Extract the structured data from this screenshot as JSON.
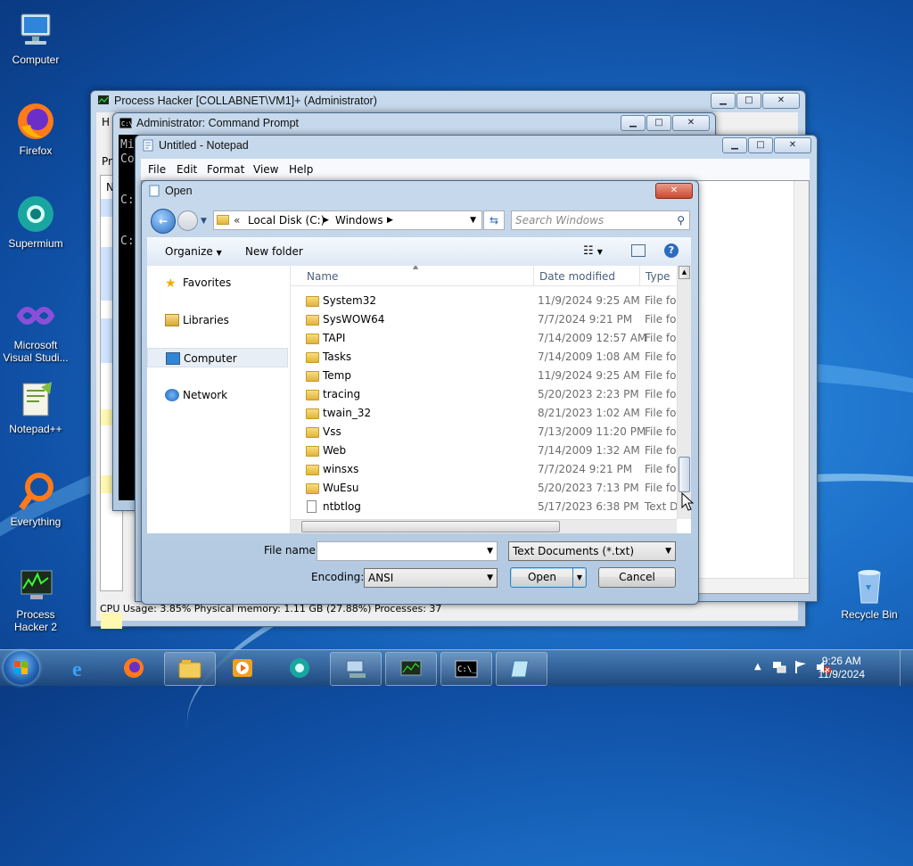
{
  "desktop": {
    "icons": [
      {
        "label": "Computer",
        "icon": "computer-icon"
      },
      {
        "label": "Firefox",
        "icon": "firefox-icon"
      },
      {
        "label": "Supermium",
        "icon": "supermium-icon"
      },
      {
        "label": "Microsoft Visual Studi...",
        "icon": "visual-studio-icon"
      },
      {
        "label": "Notepad++",
        "icon": "notepadpp-icon"
      },
      {
        "label": "Everything",
        "icon": "everything-icon"
      },
      {
        "label": "Process Hacker 2",
        "icon": "process-hacker-icon"
      },
      {
        "label": "Recycle Bin",
        "icon": "recycle-bin-icon"
      }
    ]
  },
  "process_hacker": {
    "title": "Process Hacker [COLLABNET\\VM1]+ (Administrator)",
    "menu_fragment": "H",
    "tab_fragment": "Pr",
    "col_fragment": "N",
    "status": "CPU Usage: 3.85%    Physical memory: 1.11 GB (27.88%)    Processes: 37"
  },
  "cmd": {
    "title": "Administrator:  Command Prompt",
    "lines": [
      "Mi",
      "Co",
      "",
      "C:",
      "",
      "C:"
    ]
  },
  "notepad": {
    "title": "Untitled - Notepad",
    "menu": [
      "File",
      "Edit",
      "Format",
      "View",
      "Help"
    ]
  },
  "open_dialog": {
    "title": "Open",
    "breadcrumb": [
      "Local Disk (C:)",
      "Windows"
    ],
    "search_placeholder": "Search Windows",
    "toolbar": {
      "organize": "Organize",
      "new_folder": "New folder"
    },
    "nav": [
      {
        "label": "Favorites",
        "icon": "star-icon"
      },
      {
        "label": "Libraries",
        "icon": "libraries-icon"
      },
      {
        "label": "Computer",
        "icon": "computer-icon",
        "selected": true
      },
      {
        "label": "Network",
        "icon": "network-icon"
      }
    ],
    "columns": {
      "name": "Name",
      "date": "Date modified",
      "type": "Type"
    },
    "files": [
      {
        "name": "System32",
        "date": "11/9/2024 9:25 AM",
        "type": "File fol",
        "kind": "folder"
      },
      {
        "name": "SysWOW64",
        "date": "7/7/2024 9:21 PM",
        "type": "File fol",
        "kind": "folder"
      },
      {
        "name": "TAPI",
        "date": "7/14/2009 12:57 AM",
        "type": "File fol",
        "kind": "folder"
      },
      {
        "name": "Tasks",
        "date": "7/14/2009 1:08 AM",
        "type": "File fol",
        "kind": "folder"
      },
      {
        "name": "Temp",
        "date": "11/9/2024 9:25 AM",
        "type": "File fol",
        "kind": "folder"
      },
      {
        "name": "tracing",
        "date": "5/20/2023 2:23 PM",
        "type": "File fol",
        "kind": "folder"
      },
      {
        "name": "twain_32",
        "date": "8/21/2023 1:02 AM",
        "type": "File fol",
        "kind": "folder"
      },
      {
        "name": "Vss",
        "date": "7/13/2009 11:20 PM",
        "type": "File fol",
        "kind": "folder"
      },
      {
        "name": "Web",
        "date": "7/14/2009 1:32 AM",
        "type": "File fol",
        "kind": "folder"
      },
      {
        "name": "winsxs",
        "date": "7/7/2024 9:21 PM",
        "type": "File fol",
        "kind": "folder"
      },
      {
        "name": "WuEsu",
        "date": "5/20/2023 7:13 PM",
        "type": "File fol",
        "kind": "folder"
      },
      {
        "name": "ntbtlog",
        "date": "5/17/2023 6:38 PM",
        "type": "Text D",
        "kind": "text"
      }
    ],
    "file_name_label": "File name:",
    "file_name_value": "",
    "filter": "Text Documents (*.txt)",
    "encoding_label": "Encoding:",
    "encoding": "ANSI",
    "open_label": "Open",
    "cancel_label": "Cancel"
  },
  "taskbar": {
    "time": "9:26 AM",
    "date": "11/9/2024"
  },
  "colors": {
    "accent": "#3399ff",
    "selection": "#dcebfc"
  }
}
